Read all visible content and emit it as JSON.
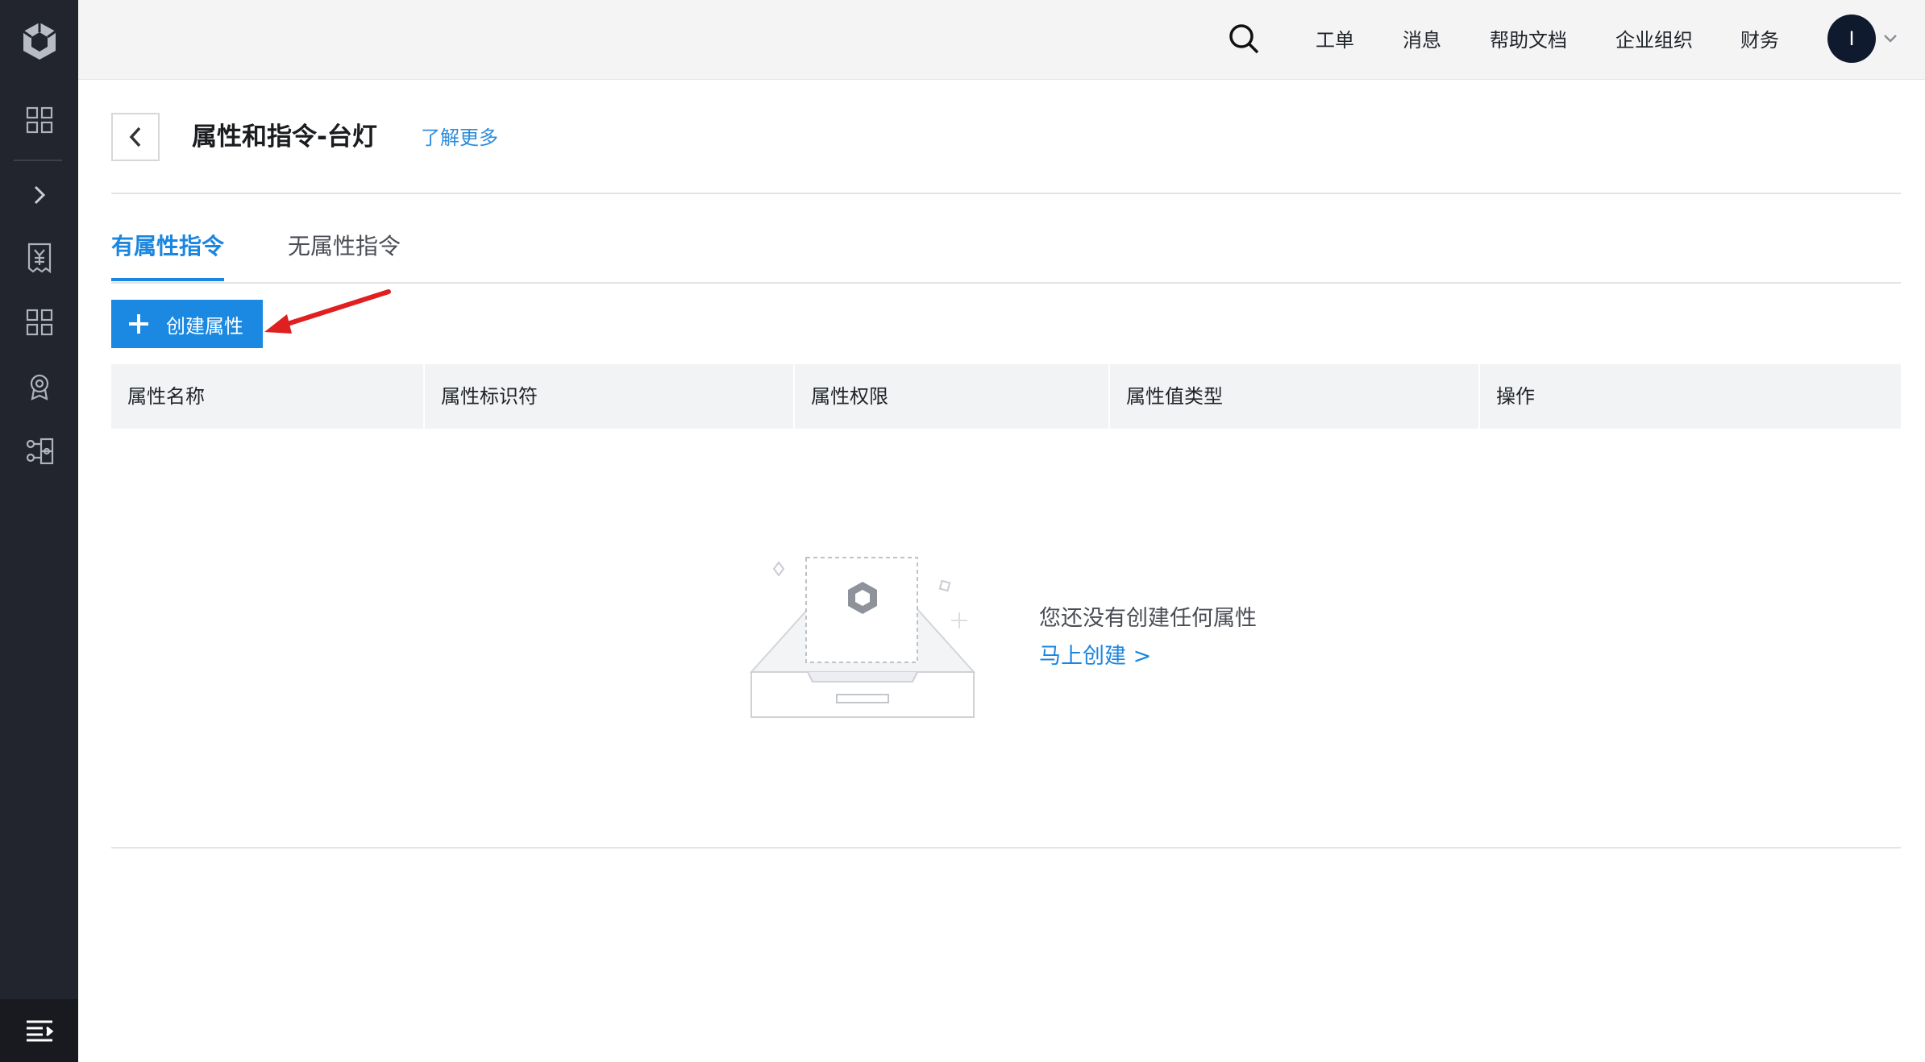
{
  "sidebar": {
    "items": [
      {
        "icon": "cube-logo-icon"
      },
      {
        "icon": "grid-icon"
      },
      {
        "icon": "chevron-right-icon"
      },
      {
        "icon": "yuan-receipt-icon"
      },
      {
        "icon": "grid-icon"
      },
      {
        "icon": "badge-icon"
      },
      {
        "icon": "network-icon"
      }
    ],
    "footer_icon": "menu-collapse-icon"
  },
  "header": {
    "search_icon": "search-icon",
    "links": [
      "工单",
      "消息",
      "帮助文档",
      "企业组织",
      "财务"
    ],
    "avatar_letter": "I"
  },
  "page": {
    "title": "属性和指令-台灯",
    "learn_more": "了解更多"
  },
  "tabs": [
    {
      "label": "有属性指令",
      "active": true
    },
    {
      "label": "无属性指令",
      "active": false
    }
  ],
  "create_button": {
    "label": "创建属性"
  },
  "table": {
    "columns": [
      "属性名称",
      "属性标识符",
      "属性权限",
      "属性值类型",
      "操作"
    ]
  },
  "empty_state": {
    "message": "您还没有创建任何属性",
    "action": "马上创建 >"
  },
  "colors": {
    "primary": "#1b88e2",
    "sidebar": "#22252e",
    "annotation_arrow": "#e02020"
  }
}
